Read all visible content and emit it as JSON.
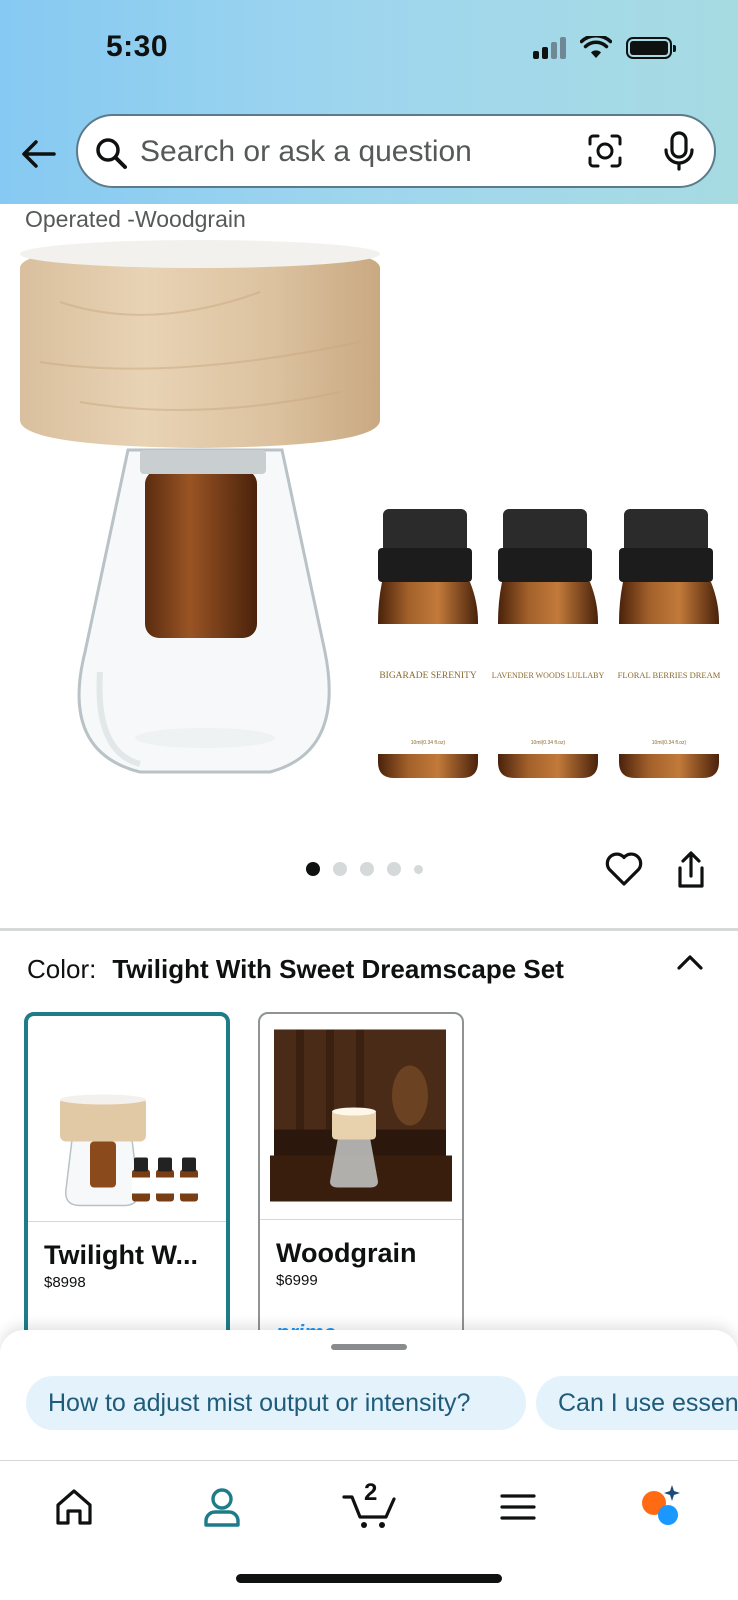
{
  "status_bar": {
    "time": "5:30"
  },
  "search": {
    "placeholder": "Search or ask a question"
  },
  "product": {
    "subtitle": "Operated -Woodgrain"
  },
  "carousel": {
    "total": 5,
    "active_index": 0
  },
  "image_labels": {
    "bottle1": "BIGARADE SERENITY",
    "bottle2": "LAVENDER WOODS LULLABY",
    "bottle3": "FLORAL BERRIES DREAM",
    "bottle_size": "10ml(0.34 fl.oz)"
  },
  "variation": {
    "label": "Color:",
    "selected_value": "Twilight With Sweet Dreamscape Set",
    "options": [
      {
        "name": "Twilight W...",
        "price_dollars": "$89",
        "price_cents": "98",
        "selected": true
      },
      {
        "name": "Woodgrain",
        "price_dollars": "$69",
        "price_cents": "99",
        "selected": false,
        "badge": "prime"
      }
    ]
  },
  "suggestions": [
    "How to adjust mist output or intensity?",
    "Can I use essent"
  ],
  "nav": {
    "cart_count": "2",
    "items": [
      "home-icon",
      "account-icon",
      "cart-icon",
      "menu-icon",
      "rufus-icon"
    ]
  },
  "colors": {
    "accent": "#1e7c89",
    "header_start": "#86c9f2",
    "header_end": "#a7dbe2",
    "chip_bg": "#e4f2fb",
    "rufus_orange": "#ff6a13",
    "rufus_blue": "#1a98ff"
  }
}
